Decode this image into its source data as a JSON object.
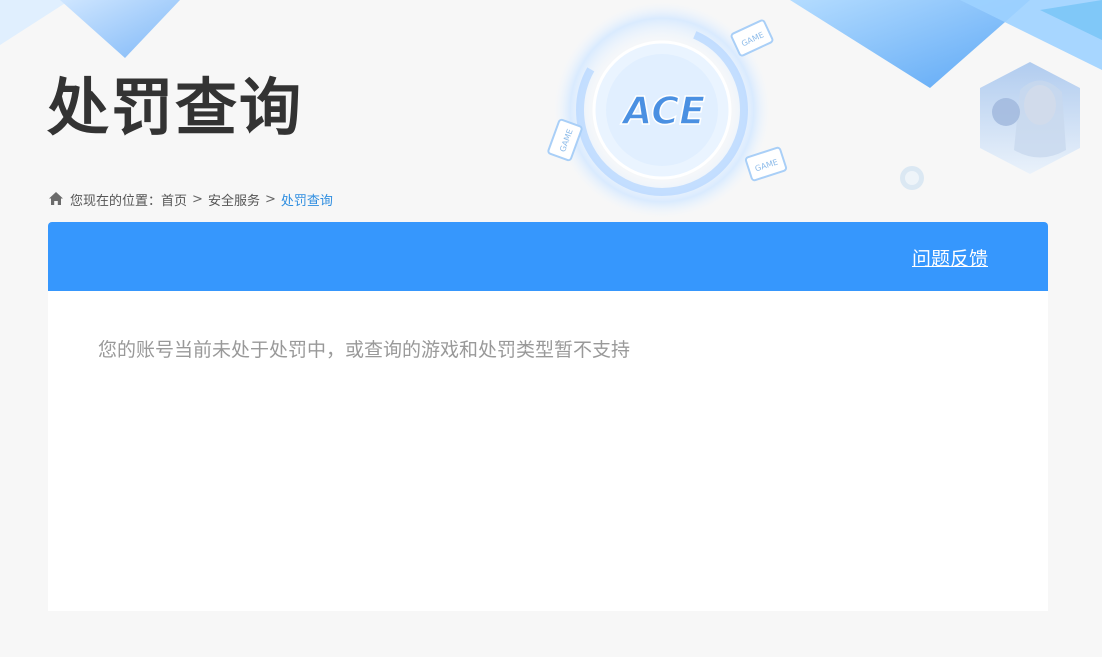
{
  "page": {
    "title": "处罚查询"
  },
  "breadcrumb": {
    "prefix": "您现在的位置：",
    "items": [
      "首页",
      "安全服务"
    ],
    "current": "处罚查询",
    "separator": ">"
  },
  "header_panel": {
    "feedback_label": "问题反馈"
  },
  "result": {
    "message": "您的账号当前未处于处罚中，或查询的游戏和处罚类型暂不支持"
  },
  "logo": {
    "text": "ACE",
    "badge": "GAME"
  },
  "colors": {
    "accent": "#3697fd",
    "title": "#333333",
    "link_current": "#2f8ee0",
    "message": "#999999",
    "background": "#f7f7f7"
  }
}
